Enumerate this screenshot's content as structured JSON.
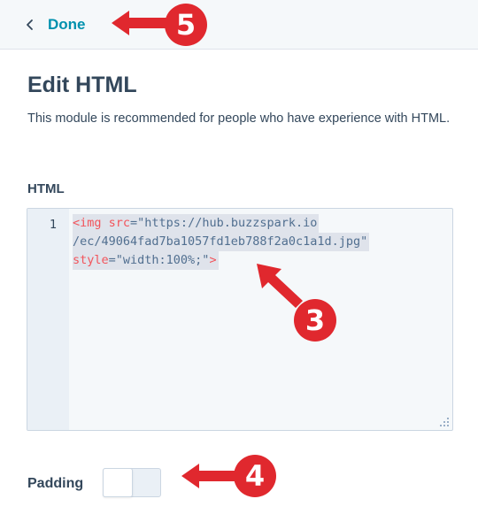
{
  "header": {
    "back_icon": "chevron-left-icon",
    "done_label": "Done"
  },
  "main": {
    "title": "Edit HTML",
    "description": "This module is recommended for people who have experience with HTML."
  },
  "editor": {
    "label": "HTML",
    "line_number": "1",
    "code": {
      "line1": {
        "tag_open": "<img ",
        "attr": "src",
        "eq_quote": "=\"",
        "value": "https://hub.buzzspark.io"
      },
      "line2": {
        "value": "/ec/49064fad7ba1057fd1eb788f2a0c1a1d.jpg\""
      },
      "line3": {
        "attr": "style",
        "eq_quote": "=\"",
        "value": "width:100%;\"",
        "tag_close": ">"
      }
    },
    "resize_icon": "resize-grip-icon"
  },
  "padding": {
    "label": "Padding",
    "enabled": false
  },
  "annotations": {
    "color": "#e0282e",
    "badge_5": "5",
    "badge_3": "3",
    "badge_4": "4"
  },
  "colors": {
    "accent": "#0091ae",
    "text": "#33475b",
    "code_tag": "#f2545b",
    "header_bg": "#f5f8fa"
  }
}
